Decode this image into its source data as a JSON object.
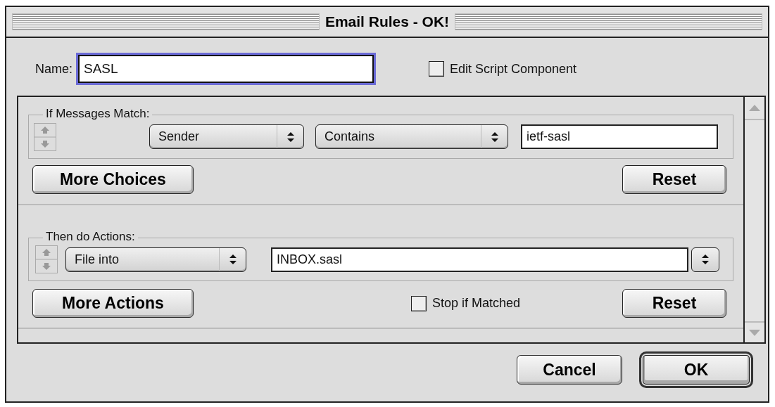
{
  "window": {
    "title": "Email Rules - OK!"
  },
  "name_field": {
    "label": "Name:",
    "value": "SASL",
    "focused": true
  },
  "edit_script": {
    "label": "Edit Script Component",
    "checked": false
  },
  "conditions": {
    "legend": "If Messages Match:",
    "field_popup": "Sender",
    "operator_popup": "Contains",
    "value": "ietf-sasl",
    "more_button": "More Choices",
    "reset_button": "Reset"
  },
  "actions": {
    "legend": "Then do Actions:",
    "action_popup": "File into",
    "value": "INBOX.sasl",
    "more_button": "More Actions",
    "stop_if_matched": {
      "label": "Stop if Matched",
      "checked": false
    },
    "reset_button": "Reset"
  },
  "buttons": [
    {
      "label": "Cancel",
      "default": false
    },
    {
      "label": "OK",
      "default": true
    }
  ]
}
